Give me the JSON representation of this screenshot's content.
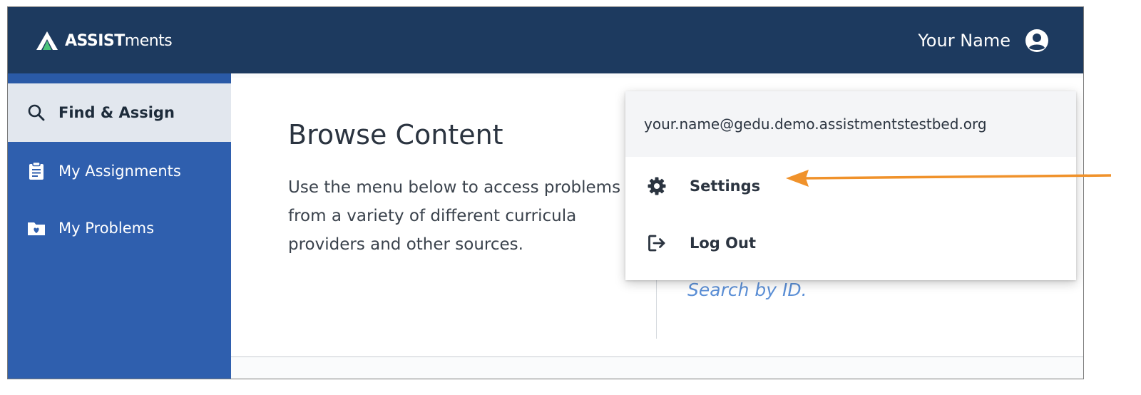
{
  "header": {
    "logo_bold": "ASSIST",
    "logo_light": "ments",
    "user_name": "Your Name"
  },
  "sidebar": {
    "items": [
      {
        "label": "Find & Assign",
        "icon": "search-icon",
        "active": true
      },
      {
        "label": "My Assignments",
        "icon": "clipboard-icon",
        "active": false
      },
      {
        "label": "My Problems",
        "icon": "folder-heart-icon",
        "active": false
      }
    ]
  },
  "main": {
    "title": "Browse Content",
    "description": "Use the menu below to access problems from a variety of different curricula providers and other sources.",
    "search_link": "Search by ID."
  },
  "user_menu": {
    "email": "your.name@gedu.demo.assistmentstestbed.org",
    "items": [
      {
        "label": "Settings",
        "icon": "gear-icon"
      },
      {
        "label": "Log Out",
        "icon": "logout-icon"
      }
    ]
  },
  "colors": {
    "header_bg": "#1d3a5f",
    "sidebar_bg": "#2f5fae",
    "active_item_bg": "#e2e7ee",
    "link": "#5b8fd6",
    "annotation_arrow": "#f0922b"
  }
}
